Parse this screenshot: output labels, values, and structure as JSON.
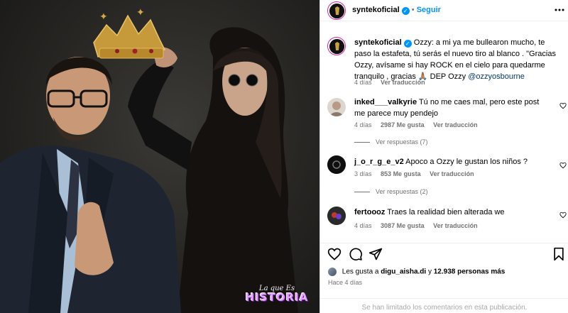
{
  "post": {
    "watermark": {
      "top": "La que Es",
      "main": "HISTORIA"
    }
  },
  "header": {
    "username": "syntekoficial",
    "verified_icon": "verified-badge-icon",
    "separator": "•",
    "follow_label": "Seguir",
    "more_icon": "more-horizontal-icon"
  },
  "caption": {
    "username": "syntekoficial",
    "text": "Ozzy: a mi ya me bullearon mucho, te paso la estafeta, tú serás el nuevo tiro al blanco . \"Gracias Ozzy, avísame si hay ROCK en el cielo para quedarme tranquilo , gracias 🙏🏽 DEP Ozzy",
    "mention": "@ozzyosbourne",
    "time": "4 días",
    "translation": "Ver traducción"
  },
  "comments": [
    {
      "username": "inked___valkyrie",
      "text": "Tú no me caes mal, pero este post me parece muy pendejo",
      "time": "4 días",
      "likes": "2987 Me gusta",
      "translation": "Ver traducción",
      "replies": "Ver respuestas (7)"
    },
    {
      "username": "j_o_r_g_e_v2",
      "text": "Apoco a Ozzy le gustan los niños ?",
      "time": "3 días",
      "likes": "853 Me gusta",
      "translation": "Ver traducción",
      "replies": "Ver respuestas (2)"
    },
    {
      "username": "fertoooz",
      "text": "Traes la realidad bien alterada we",
      "time": "4 días",
      "likes": "3087 Me gusta",
      "translation": "Ver traducción",
      "replies": ""
    }
  ],
  "actions": {
    "like_icon": "heart-icon",
    "comment_icon": "comment-icon",
    "share_icon": "share-icon",
    "save_icon": "bookmark-icon"
  },
  "likes": {
    "prefix": "Les gusta a",
    "user": "digu_aisha.di",
    "middle": "y",
    "count": "12.938 personas más"
  },
  "time_ago": "Hace 4 días",
  "comments_limited": "Se han limitado los comentarios en esta publicación.",
  "colors": {
    "accent_blue": "#0095f6",
    "secondary_text": "#737373",
    "border": "#dbdbdb",
    "story_ring": "#d6249f"
  }
}
